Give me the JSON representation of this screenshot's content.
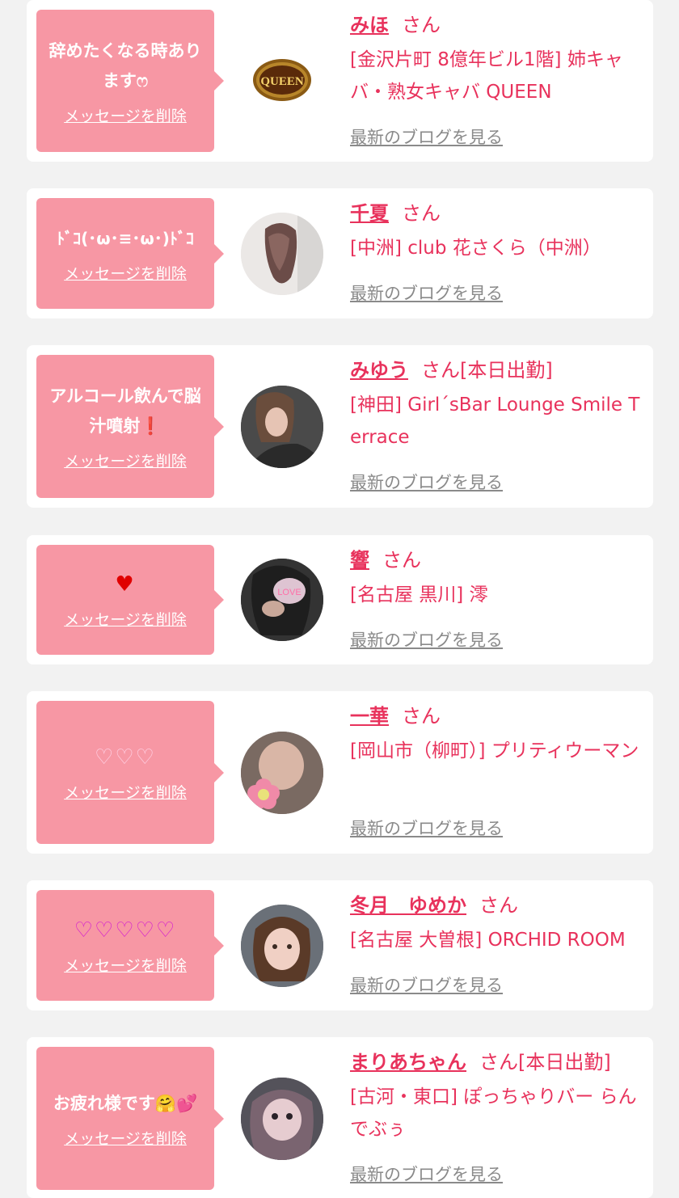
{
  "colors": {
    "background": "#f2f2f2",
    "card": "#ffffff",
    "bubble": "#f797a4",
    "accent": "#e8325c",
    "link_gray": "#8a8a8a"
  },
  "labels": {
    "delete_message": "メッセージを削除",
    "view_blog": "最新のブログを見る",
    "honorific": "さん"
  },
  "entries": [
    {
      "message": "辞めたくなる時ありますෆ",
      "name": "みほ",
      "status": "",
      "shop": "[金沢片町 8億年ビル1階] 姉キャバ・熟女キャバ QUEEN",
      "avatar_label": "QUEEN"
    },
    {
      "message": "ﾄﾞｺ(･ω･≡･ω･)ﾄﾞｺ",
      "name": "千夏",
      "status": "",
      "shop": "[中洲] club 花さくら（中洲）"
    },
    {
      "message": "アルコール飲んで脳汁噴射❗️",
      "name": "みゆう",
      "status": "[本日出勤]",
      "shop": "[神田] Girl´sBar Lounge Smile Terrace"
    },
    {
      "message": "♥",
      "name": "響",
      "status": "",
      "shop": "[名古屋 黒川] 澪",
      "avatar_label": "LOVE"
    },
    {
      "message": "♡♡♡",
      "name": "一華",
      "status": "",
      "shop": "[岡山市（柳町）] プリティウーマン"
    },
    {
      "message": "♡♡♡♡♡",
      "name": "冬月　ゆめか",
      "status": "",
      "shop": "[名古屋 大曽根] ORCHID ROOM"
    },
    {
      "message": "お疲れ様です🤗💕",
      "name": "まりあちゃん",
      "status": "[本日出勤]",
      "shop": "[古河・東口] ぽっちゃりバー らんでぶぅ"
    }
  ]
}
